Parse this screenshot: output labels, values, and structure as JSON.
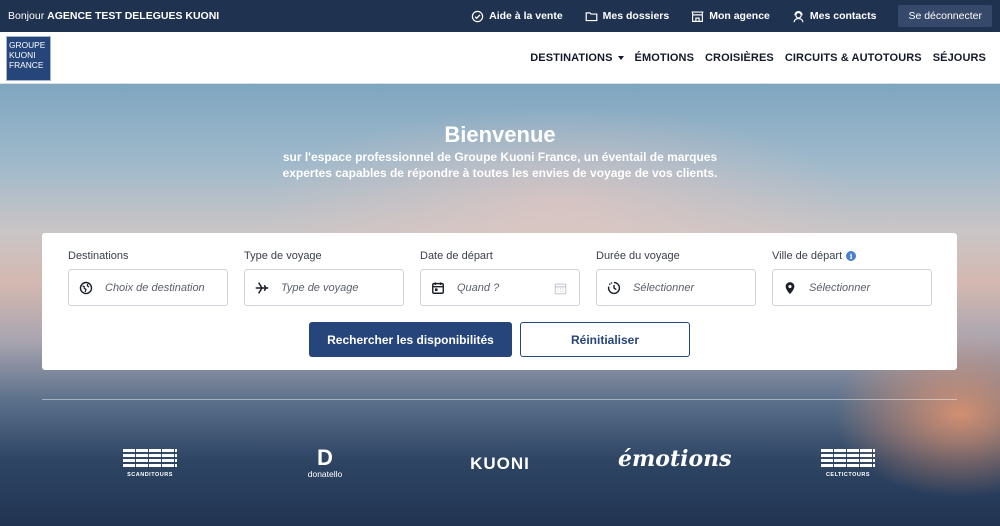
{
  "topbar": {
    "greeting_prefix": "Bonjour",
    "agency_name": "AGENCE TEST DELEGUES KUONI",
    "links": [
      {
        "label": "Aide à la vente",
        "icon": "badge-check-icon"
      },
      {
        "label": "Mes dossiers",
        "icon": "folder-icon"
      },
      {
        "label": "Mon agence",
        "icon": "storefront-icon"
      },
      {
        "label": "Mes contacts",
        "icon": "support-agent-icon"
      }
    ],
    "logout_label": "Se déconnecter"
  },
  "navbar": {
    "logo_lines": [
      "GROUPE",
      "KUONI",
      "FRANCE"
    ],
    "links": [
      "DESTINATIONS",
      "ÉMOTIONS",
      "CROISIÈRES",
      "CIRCUITS & AUTOTOURS",
      "SÉJOURS"
    ]
  },
  "hero": {
    "title": "Bienvenue",
    "subtitle": "sur l'espace professionnel de Groupe Kuoni France, un éventail de marques expertes capables de répondre à toutes les envies de voyage de vos clients."
  },
  "search": {
    "fields": [
      {
        "label": "Destinations",
        "placeholder": "Choix de destination",
        "icon": "globe-icon"
      },
      {
        "label": "Type de voyage",
        "placeholder": "Type de voyage",
        "icon": "plane-icon"
      },
      {
        "label": "Date de départ",
        "placeholder": "Quand ?",
        "icon": "calendar-icon"
      },
      {
        "label": "Durée du voyage",
        "placeholder": "Sélectionner",
        "icon": "clock-icon"
      },
      {
        "label": "Ville de départ",
        "placeholder": "Sélectionner",
        "icon": "map-pin-icon"
      }
    ],
    "search_button": "Rechercher les disponibilités",
    "reset_button": "Réinitialiser"
  },
  "brands": {
    "scanditours": "SCANDITOURS",
    "donatello_letter": "D",
    "donatello": "donatello",
    "kuoni": "KUONI",
    "emotions": "émotions",
    "celtictours": "CELTICTOURS"
  }
}
